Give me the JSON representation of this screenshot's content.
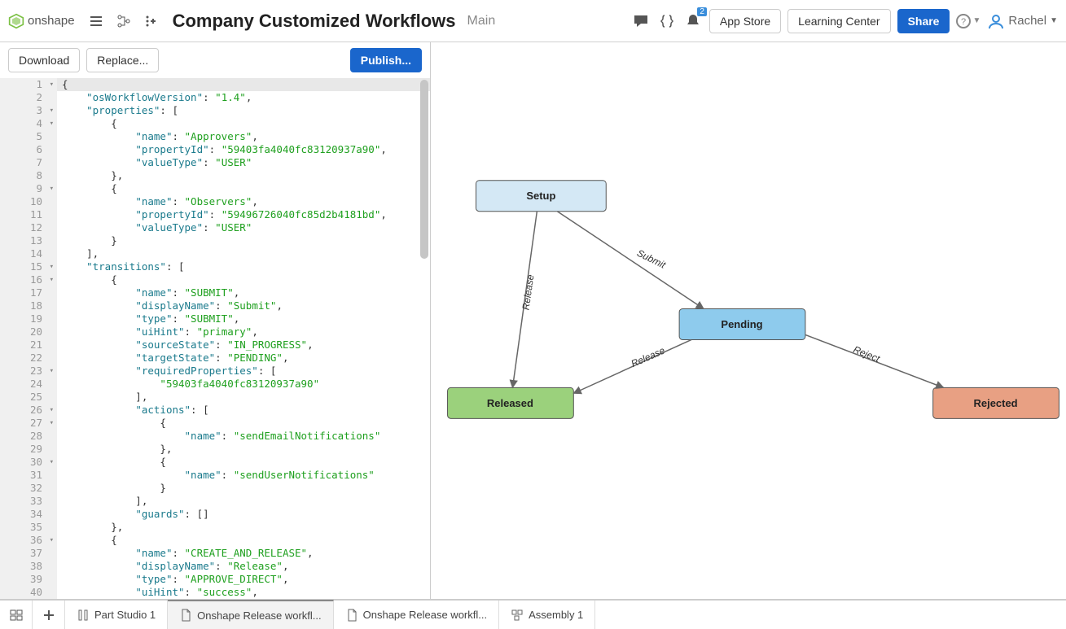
{
  "header": {
    "logo_text": "onshape",
    "doc_title": "Company Customized Workflows",
    "branch": "Main",
    "app_store": "App Store",
    "learning_center": "Learning Center",
    "share": "Share",
    "user_name": "Rachel",
    "notif_count": "2"
  },
  "left_toolbar": {
    "download": "Download",
    "replace": "Replace...",
    "publish": "Publish..."
  },
  "code_lines": [
    {
      "n": "1",
      "fold": true,
      "first": true,
      "tokens": [
        {
          "t": "{",
          "c": "p"
        }
      ]
    },
    {
      "n": "2",
      "tokens": [
        {
          "t": "    ",
          "c": "p"
        },
        {
          "t": "\"osWorkflowVersion\"",
          "c": "k"
        },
        {
          "t": ": ",
          "c": "p"
        },
        {
          "t": "\"1.4\"",
          "c": "s"
        },
        {
          "t": ",",
          "c": "p"
        }
      ]
    },
    {
      "n": "3",
      "fold": true,
      "tokens": [
        {
          "t": "    ",
          "c": "p"
        },
        {
          "t": "\"properties\"",
          "c": "k"
        },
        {
          "t": ": [",
          "c": "p"
        }
      ]
    },
    {
      "n": "4",
      "fold": true,
      "tokens": [
        {
          "t": "        {",
          "c": "p"
        }
      ]
    },
    {
      "n": "5",
      "tokens": [
        {
          "t": "            ",
          "c": "p"
        },
        {
          "t": "\"name\"",
          "c": "k"
        },
        {
          "t": ": ",
          "c": "p"
        },
        {
          "t": "\"Approvers\"",
          "c": "s"
        },
        {
          "t": ",",
          "c": "p"
        }
      ]
    },
    {
      "n": "6",
      "tokens": [
        {
          "t": "            ",
          "c": "p"
        },
        {
          "t": "\"propertyId\"",
          "c": "k"
        },
        {
          "t": ": ",
          "c": "p"
        },
        {
          "t": "\"59403fa4040fc83120937a90\"",
          "c": "s"
        },
        {
          "t": ",",
          "c": "p"
        }
      ]
    },
    {
      "n": "7",
      "tokens": [
        {
          "t": "            ",
          "c": "p"
        },
        {
          "t": "\"valueType\"",
          "c": "k"
        },
        {
          "t": ": ",
          "c": "p"
        },
        {
          "t": "\"USER\"",
          "c": "s"
        }
      ]
    },
    {
      "n": "8",
      "tokens": [
        {
          "t": "        },",
          "c": "p"
        }
      ]
    },
    {
      "n": "9",
      "fold": true,
      "tokens": [
        {
          "t": "        {",
          "c": "p"
        }
      ]
    },
    {
      "n": "10",
      "tokens": [
        {
          "t": "            ",
          "c": "p"
        },
        {
          "t": "\"name\"",
          "c": "k"
        },
        {
          "t": ": ",
          "c": "p"
        },
        {
          "t": "\"Observers\"",
          "c": "s"
        },
        {
          "t": ",",
          "c": "p"
        }
      ]
    },
    {
      "n": "11",
      "tokens": [
        {
          "t": "            ",
          "c": "p"
        },
        {
          "t": "\"propertyId\"",
          "c": "k"
        },
        {
          "t": ": ",
          "c": "p"
        },
        {
          "t": "\"59496726040fc85d2b4181bd\"",
          "c": "s"
        },
        {
          "t": ",",
          "c": "p"
        }
      ]
    },
    {
      "n": "12",
      "tokens": [
        {
          "t": "            ",
          "c": "p"
        },
        {
          "t": "\"valueType\"",
          "c": "k"
        },
        {
          "t": ": ",
          "c": "p"
        },
        {
          "t": "\"USER\"",
          "c": "s"
        }
      ]
    },
    {
      "n": "13",
      "tokens": [
        {
          "t": "        }",
          "c": "p"
        }
      ]
    },
    {
      "n": "14",
      "tokens": [
        {
          "t": "    ],",
          "c": "p"
        }
      ]
    },
    {
      "n": "15",
      "fold": true,
      "tokens": [
        {
          "t": "    ",
          "c": "p"
        },
        {
          "t": "\"transitions\"",
          "c": "k"
        },
        {
          "t": ": [",
          "c": "p"
        }
      ]
    },
    {
      "n": "16",
      "fold": true,
      "tokens": [
        {
          "t": "        {",
          "c": "p"
        }
      ]
    },
    {
      "n": "17",
      "tokens": [
        {
          "t": "            ",
          "c": "p"
        },
        {
          "t": "\"name\"",
          "c": "k"
        },
        {
          "t": ": ",
          "c": "p"
        },
        {
          "t": "\"SUBMIT\"",
          "c": "s"
        },
        {
          "t": ",",
          "c": "p"
        }
      ]
    },
    {
      "n": "18",
      "tokens": [
        {
          "t": "            ",
          "c": "p"
        },
        {
          "t": "\"displayName\"",
          "c": "k"
        },
        {
          "t": ": ",
          "c": "p"
        },
        {
          "t": "\"Submit\"",
          "c": "s"
        },
        {
          "t": ",",
          "c": "p"
        }
      ]
    },
    {
      "n": "19",
      "tokens": [
        {
          "t": "            ",
          "c": "p"
        },
        {
          "t": "\"type\"",
          "c": "k"
        },
        {
          "t": ": ",
          "c": "p"
        },
        {
          "t": "\"SUBMIT\"",
          "c": "s"
        },
        {
          "t": ",",
          "c": "p"
        }
      ]
    },
    {
      "n": "20",
      "tokens": [
        {
          "t": "            ",
          "c": "p"
        },
        {
          "t": "\"uiHint\"",
          "c": "k"
        },
        {
          "t": ": ",
          "c": "p"
        },
        {
          "t": "\"primary\"",
          "c": "s"
        },
        {
          "t": ",",
          "c": "p"
        }
      ]
    },
    {
      "n": "21",
      "tokens": [
        {
          "t": "            ",
          "c": "p"
        },
        {
          "t": "\"sourceState\"",
          "c": "k"
        },
        {
          "t": ": ",
          "c": "p"
        },
        {
          "t": "\"IN_PROGRESS\"",
          "c": "s"
        },
        {
          "t": ",",
          "c": "p"
        }
      ]
    },
    {
      "n": "22",
      "tokens": [
        {
          "t": "            ",
          "c": "p"
        },
        {
          "t": "\"targetState\"",
          "c": "k"
        },
        {
          "t": ": ",
          "c": "p"
        },
        {
          "t": "\"PENDING\"",
          "c": "s"
        },
        {
          "t": ",",
          "c": "p"
        }
      ]
    },
    {
      "n": "23",
      "fold": true,
      "tokens": [
        {
          "t": "            ",
          "c": "p"
        },
        {
          "t": "\"requiredProperties\"",
          "c": "k"
        },
        {
          "t": ": [",
          "c": "p"
        }
      ]
    },
    {
      "n": "24",
      "tokens": [
        {
          "t": "                ",
          "c": "p"
        },
        {
          "t": "\"59403fa4040fc83120937a90\"",
          "c": "s"
        }
      ]
    },
    {
      "n": "25",
      "tokens": [
        {
          "t": "            ],",
          "c": "p"
        }
      ]
    },
    {
      "n": "26",
      "fold": true,
      "tokens": [
        {
          "t": "            ",
          "c": "p"
        },
        {
          "t": "\"actions\"",
          "c": "k"
        },
        {
          "t": ": [",
          "c": "p"
        }
      ]
    },
    {
      "n": "27",
      "fold": true,
      "tokens": [
        {
          "t": "                {",
          "c": "p"
        }
      ]
    },
    {
      "n": "28",
      "tokens": [
        {
          "t": "                    ",
          "c": "p"
        },
        {
          "t": "\"name\"",
          "c": "k"
        },
        {
          "t": ": ",
          "c": "p"
        },
        {
          "t": "\"sendEmailNotifications\"",
          "c": "s"
        }
      ]
    },
    {
      "n": "29",
      "tokens": [
        {
          "t": "                },",
          "c": "p"
        }
      ]
    },
    {
      "n": "30",
      "fold": true,
      "tokens": [
        {
          "t": "                {",
          "c": "p"
        }
      ]
    },
    {
      "n": "31",
      "tokens": [
        {
          "t": "                    ",
          "c": "p"
        },
        {
          "t": "\"name\"",
          "c": "k"
        },
        {
          "t": ": ",
          "c": "p"
        },
        {
          "t": "\"sendUserNotifications\"",
          "c": "s"
        }
      ]
    },
    {
      "n": "32",
      "tokens": [
        {
          "t": "                }",
          "c": "p"
        }
      ]
    },
    {
      "n": "33",
      "tokens": [
        {
          "t": "            ],",
          "c": "p"
        }
      ]
    },
    {
      "n": "34",
      "tokens": [
        {
          "t": "            ",
          "c": "p"
        },
        {
          "t": "\"guards\"",
          "c": "k"
        },
        {
          "t": ": []",
          "c": "p"
        }
      ]
    },
    {
      "n": "35",
      "tokens": [
        {
          "t": "        },",
          "c": "p"
        }
      ]
    },
    {
      "n": "36",
      "fold": true,
      "tokens": [
        {
          "t": "        {",
          "c": "p"
        }
      ]
    },
    {
      "n": "37",
      "tokens": [
        {
          "t": "            ",
          "c": "p"
        },
        {
          "t": "\"name\"",
          "c": "k"
        },
        {
          "t": ": ",
          "c": "p"
        },
        {
          "t": "\"CREATE_AND_RELEASE\"",
          "c": "s"
        },
        {
          "t": ",",
          "c": "p"
        }
      ]
    },
    {
      "n": "38",
      "tokens": [
        {
          "t": "            ",
          "c": "p"
        },
        {
          "t": "\"displayName\"",
          "c": "k"
        },
        {
          "t": ": ",
          "c": "p"
        },
        {
          "t": "\"Release\"",
          "c": "s"
        },
        {
          "t": ",",
          "c": "p"
        }
      ]
    },
    {
      "n": "39",
      "tokens": [
        {
          "t": "            ",
          "c": "p"
        },
        {
          "t": "\"type\"",
          "c": "k"
        },
        {
          "t": ": ",
          "c": "p"
        },
        {
          "t": "\"APPROVE_DIRECT\"",
          "c": "s"
        },
        {
          "t": ",",
          "c": "p"
        }
      ]
    },
    {
      "n": "40",
      "tokens": [
        {
          "t": "            ",
          "c": "p"
        },
        {
          "t": "\"uiHint\"",
          "c": "k"
        },
        {
          "t": ": ",
          "c": "p"
        },
        {
          "t": "\"success\"",
          "c": "s"
        },
        {
          "t": ",",
          "c": "p"
        }
      ]
    }
  ],
  "diagram": {
    "nodes": {
      "setup": "Setup",
      "pending": "Pending",
      "released": "Released",
      "rejected": "Rejected"
    },
    "edges": {
      "submit": "Submit",
      "release1": "Release",
      "release2": "Release",
      "reject": "Reject"
    }
  },
  "tabs": [
    {
      "label": "Part Studio 1",
      "active": false
    },
    {
      "label": "Onshape Release workfl...",
      "active": true
    },
    {
      "label": "Onshape Release workfl...",
      "active": false
    },
    {
      "label": "Assembly 1",
      "active": false
    }
  ]
}
